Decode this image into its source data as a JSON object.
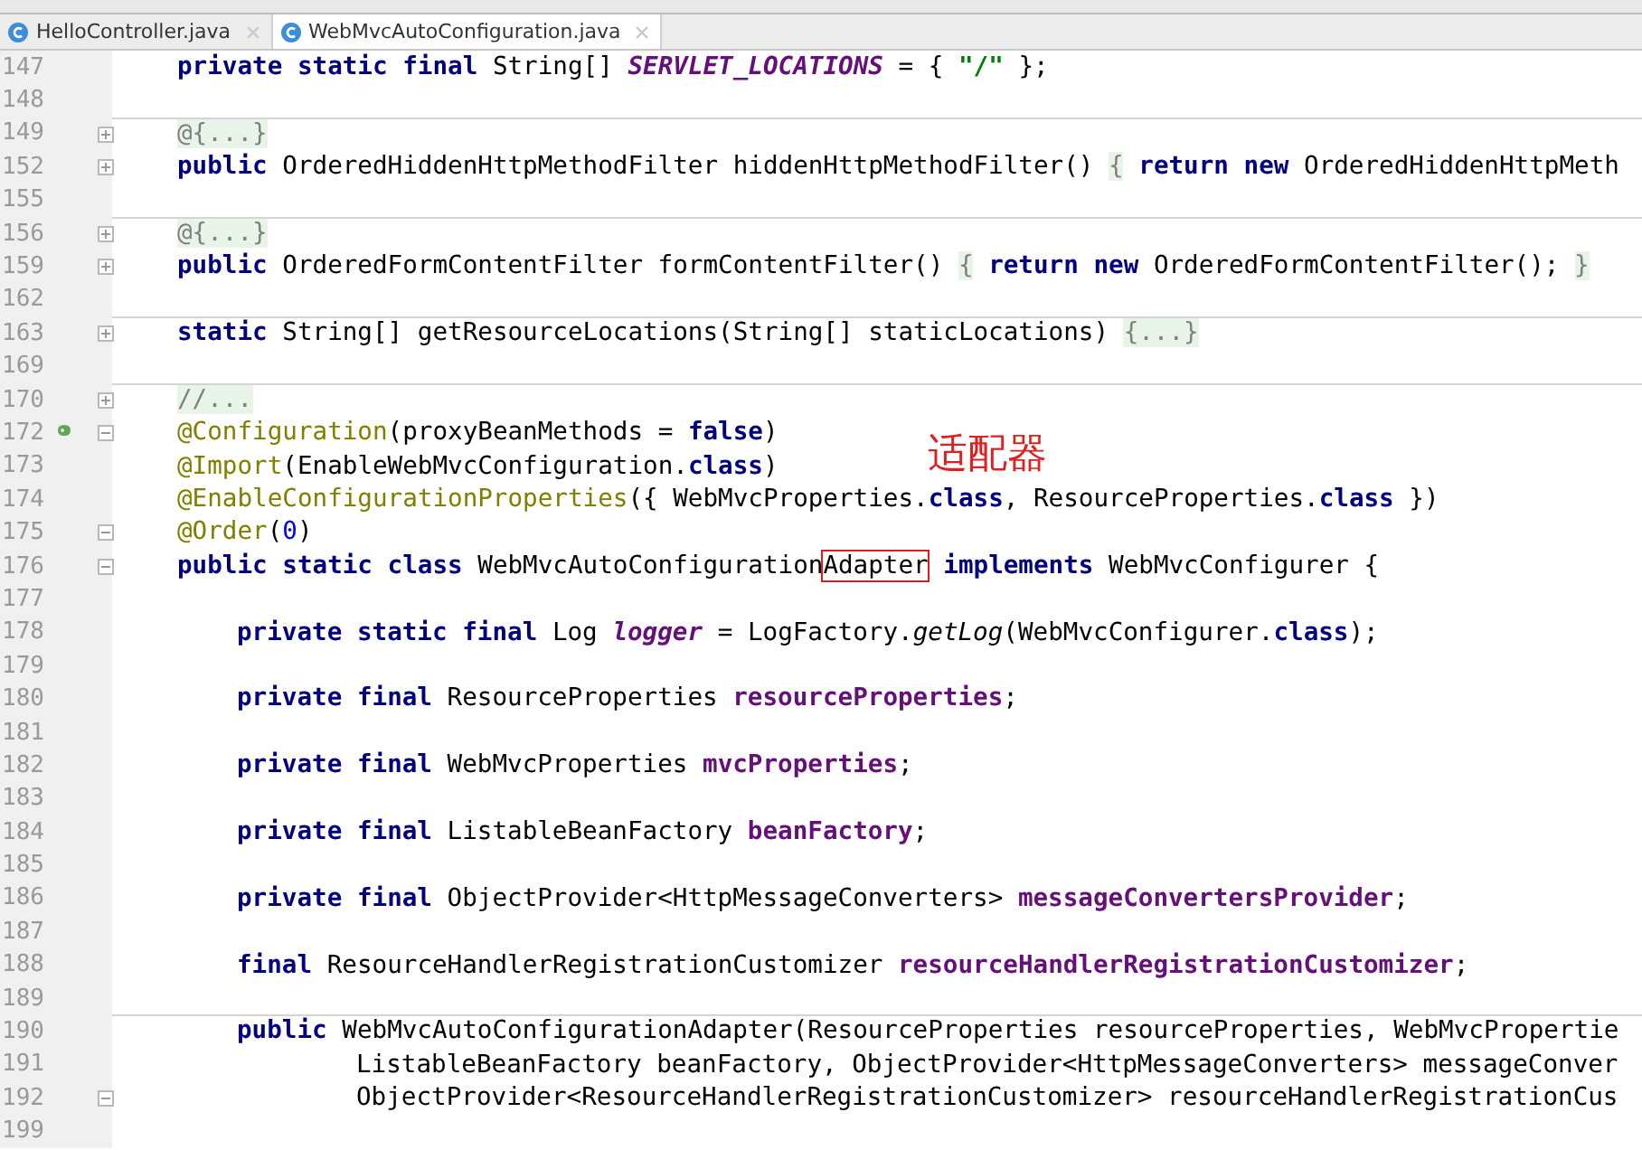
{
  "tabs": [
    {
      "label": "HelloController.java",
      "selected": false
    },
    {
      "label": "WebMvcAutoConfiguration.java",
      "selected": true
    }
  ],
  "editor": {
    "note": "适配器",
    "lines": [
      {
        "number": "147",
        "kind": "class_member",
        "tokens": [
          {
            "kind": "keyword",
            "text": "private static final"
          },
          {
            "kind": "plain",
            "text": " String[] "
          },
          {
            "kind": "static_field",
            "text": "SERVLET_LOCATIONS"
          },
          {
            "kind": "plain",
            "text": " = { "
          },
          {
            "kind": "string",
            "text": "\"/\""
          },
          {
            "kind": "plain",
            "text": " };"
          }
        ]
      },
      {
        "number": "148"
      },
      {
        "number": "149",
        "separator": true,
        "collapsed": true,
        "kind": "class_member",
        "tokens": [
          {
            "kind": "folded",
            "text": "@{...}"
          }
        ]
      },
      {
        "number": "152",
        "collapsed": true,
        "kind": "class_member",
        "tokens": [
          {
            "kind": "keyword",
            "text": "public"
          },
          {
            "kind": "plain",
            "text": " OrderedHiddenHttpMethodFilter hiddenHttpMethodFilter() "
          },
          {
            "kind": "folded",
            "text": "{"
          },
          {
            "kind": "keyword",
            "text": " return new"
          },
          {
            "kind": "plain",
            "text": " OrderedHiddenHttpMeth"
          }
        ]
      },
      {
        "number": "155"
      },
      {
        "number": "156",
        "separator": true,
        "collapsed": true,
        "kind": "class_member",
        "tokens": [
          {
            "kind": "folded",
            "text": "@{...}"
          }
        ]
      },
      {
        "number": "159",
        "collapsed": true,
        "kind": "class_member",
        "tokens": [
          {
            "kind": "keyword",
            "text": "public"
          },
          {
            "kind": "plain",
            "text": " OrderedFormContentFilter formContentFilter() "
          },
          {
            "kind": "folded",
            "text": "{"
          },
          {
            "kind": "keyword",
            "text": " return new"
          },
          {
            "kind": "plain",
            "text": " OrderedFormContentFilter(); "
          },
          {
            "kind": "folded",
            "text": "}"
          }
        ]
      },
      {
        "number": "162"
      },
      {
        "number": "163",
        "separator": true,
        "collapsed": true,
        "kind": "class_member",
        "tokens": [
          {
            "kind": "keyword",
            "text": "static"
          },
          {
            "kind": "plain",
            "text": " String[] getResourceLocations(String[] staticLocations) "
          },
          {
            "kind": "folded",
            "text": "{...}"
          }
        ]
      },
      {
        "number": "169"
      },
      {
        "number": "170",
        "separator": true,
        "collapsed": true,
        "kind": "class_member",
        "tokens": [
          {
            "kind": "folded",
            "text": "//..."
          }
        ]
      },
      {
        "number": "172",
        "bean": true,
        "collapsed": false,
        "kind": "class_member",
        "tokens": [
          {
            "kind": "annotation",
            "text": "@Configuration"
          },
          {
            "kind": "plain",
            "text": "(proxyBeanMethods = "
          },
          {
            "kind": "keyword",
            "text": "false"
          },
          {
            "kind": "plain",
            "text": ")"
          }
        ]
      },
      {
        "number": "173",
        "kind": "class_member",
        "tokens": [
          {
            "kind": "annotation",
            "text": "@Import"
          },
          {
            "kind": "plain",
            "text": "(EnableWebMvcConfiguration."
          },
          {
            "kind": "keyword",
            "text": "class"
          },
          {
            "kind": "plain",
            "text": ")"
          }
        ]
      },
      {
        "number": "174",
        "kind": "class_member",
        "tokens": [
          {
            "kind": "annotation",
            "text": "@EnableConfigurationProperties"
          },
          {
            "kind": "plain",
            "text": "({ WebMvcProperties."
          },
          {
            "kind": "keyword",
            "text": "class"
          },
          {
            "kind": "plain",
            "text": ", ResourceProperties."
          },
          {
            "kind": "keyword",
            "text": "class"
          },
          {
            "kind": "plain",
            "text": " })"
          }
        ]
      },
      {
        "number": "175",
        "collapsed": false,
        "kind": "class_member",
        "tokens": [
          {
            "kind": "annotation",
            "text": "@Order"
          },
          {
            "kind": "plain",
            "text": "("
          },
          {
            "kind": "number",
            "text": "0"
          },
          {
            "kind": "plain",
            "text": ")"
          }
        ]
      },
      {
        "number": "176",
        "collapsed": false,
        "kind": "class_member",
        "tokens": [
          {
            "kind": "keyword",
            "text": "public static class"
          },
          {
            "kind": "plain",
            "text": " WebMvcAutoConfiguration"
          },
          {
            "kind": "boxed",
            "text": "Adapter"
          },
          {
            "kind": "keyword",
            "text": " implements"
          },
          {
            "kind": "plain",
            "text": " WebMvcConfigurer {"
          }
        ]
      },
      {
        "number": "177"
      },
      {
        "number": "178",
        "kind": "inner_member",
        "tokens": [
          {
            "kind": "keyword",
            "text": "private static final"
          },
          {
            "kind": "plain",
            "text": " Log "
          },
          {
            "kind": "static_field",
            "text": "logger"
          },
          {
            "kind": "plain",
            "text": " = LogFactory."
          },
          {
            "kind": "static_method",
            "text": "getLog"
          },
          {
            "kind": "plain",
            "text": "(WebMvcConfigurer."
          },
          {
            "kind": "keyword",
            "text": "class"
          },
          {
            "kind": "plain",
            "text": ");"
          }
        ]
      },
      {
        "number": "179"
      },
      {
        "number": "180",
        "kind": "inner_member",
        "tokens": [
          {
            "kind": "keyword",
            "text": "private final"
          },
          {
            "kind": "plain",
            "text": " ResourceProperties "
          },
          {
            "kind": "field",
            "text": "resourceProperties"
          },
          {
            "kind": "plain",
            "text": ";"
          }
        ]
      },
      {
        "number": "181"
      },
      {
        "number": "182",
        "kind": "inner_member",
        "tokens": [
          {
            "kind": "keyword",
            "text": "private final"
          },
          {
            "kind": "plain",
            "text": " WebMvcProperties "
          },
          {
            "kind": "field",
            "text": "mvcProperties"
          },
          {
            "kind": "plain",
            "text": ";"
          }
        ]
      },
      {
        "number": "183"
      },
      {
        "number": "184",
        "kind": "inner_member",
        "tokens": [
          {
            "kind": "keyword",
            "text": "private final"
          },
          {
            "kind": "plain",
            "text": " ListableBeanFactory "
          },
          {
            "kind": "field",
            "text": "beanFactory"
          },
          {
            "kind": "plain",
            "text": ";"
          }
        ]
      },
      {
        "number": "185"
      },
      {
        "number": "186",
        "kind": "inner_member",
        "tokens": [
          {
            "kind": "keyword",
            "text": "private final"
          },
          {
            "kind": "plain",
            "text": " ObjectProvider<HttpMessageConverters> "
          },
          {
            "kind": "field",
            "text": "messageConvertersProvider"
          },
          {
            "kind": "plain",
            "text": ";"
          }
        ]
      },
      {
        "number": "187"
      },
      {
        "number": "188",
        "kind": "inner_member",
        "tokens": [
          {
            "kind": "keyword",
            "text": "final"
          },
          {
            "kind": "plain",
            "text": " ResourceHandlerRegistrationCustomizer "
          },
          {
            "kind": "field",
            "text": "resourceHandlerRegistrationCustomizer"
          },
          {
            "kind": "plain",
            "text": ";"
          }
        ]
      },
      {
        "number": "189"
      },
      {
        "number": "190",
        "separator": true,
        "kind": "inner_member",
        "tokens": [
          {
            "kind": "keyword",
            "text": "public"
          },
          {
            "kind": "plain",
            "text": " WebMvcAutoConfigurationAdapter(ResourceProperties resourceProperties, WebMvcPropertie"
          }
        ]
      },
      {
        "number": "191",
        "kind": "continuation",
        "tokens": [
          {
            "kind": "plain",
            "text": "ListableBeanFactory beanFactory, ObjectProvider<HttpMessageConverters> messageConver"
          }
        ]
      },
      {
        "number": "192",
        "collapsed": false,
        "kind": "continuation",
        "tokens": [
          {
            "kind": "plain",
            "text": "ObjectProvider<ResourceHandlerRegistrationCustomizer> resourceHandlerRegistrationCus"
          }
        ]
      },
      {
        "number": "199"
      }
    ]
  }
}
